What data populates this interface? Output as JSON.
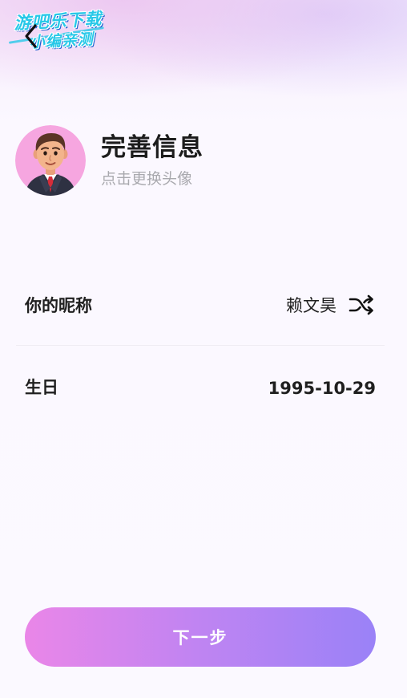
{
  "watermark": {
    "line1": "游吧乐下载",
    "line2": "小编亲测"
  },
  "header": {
    "title": "完善信息",
    "subtitle": "点击更换头像"
  },
  "form": {
    "nickname": {
      "label": "你的昵称",
      "value": "赖文昊"
    },
    "birthday": {
      "label": "生日",
      "value": "1995-10-29"
    }
  },
  "footer": {
    "next_label": "下一步"
  },
  "colors": {
    "accent_start": "#ea86e8",
    "accent_end": "#9a82f7",
    "avatar_bg": "#f6a6e0",
    "watermark": "#27c8e8"
  },
  "icons": {
    "back": "chevron-left-icon",
    "shuffle": "shuffle-icon",
    "avatar": "avatar-image"
  }
}
